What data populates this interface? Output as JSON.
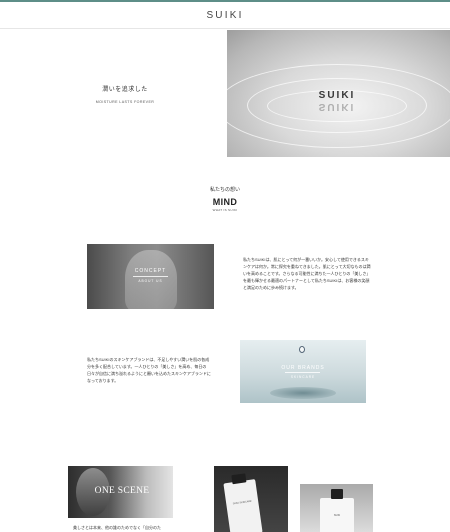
{
  "brand": {
    "name": "SUIKI"
  },
  "hero": {
    "title_jp": "潤いを追求した",
    "subtitle_en": "MOISTURE LASTS FOREVER",
    "image_word": "SUIKI"
  },
  "mind": {
    "title_jp": "私たちの想い",
    "title": "MIND",
    "subtitle": "WHAT IS SUIKI"
  },
  "concept": {
    "image_title": "CONCEPT",
    "image_subtitle": "ABOUT US",
    "body": "私たちSUIKIは、肌にとって何が一番いいか。安心して使用できるスキンケアは何か。常に探究を重ねてきました。肌にとって大切なものは潤いを高めることです。さらなる可能性に満ちた一人ひとりの「美しさ」を最も輝かせる最適のパートナーとして私たちSUIKIは、お客様の笑顔と満足のために歩み続けます。"
  },
  "brands": {
    "body": "私たちSUIKIのスキンケアブランドは、不足しやすい潤いを肌の各成分を多く配合しています。一人ひとりの「美しさ」を高め、毎日の日々が自信に満ち溢れるようにと願いを込めたスキンケアブランドになっております。",
    "image_title": "OUR BRANDS",
    "image_subtitle": "SKINCARE"
  },
  "scene": {
    "image_title": "ONE SCENE",
    "body": "美しさとは本来、他の誰のためでなく「自分のた"
  },
  "products": {
    "label1": "SUIKI SKINCARE",
    "label2": "SUIKI"
  }
}
